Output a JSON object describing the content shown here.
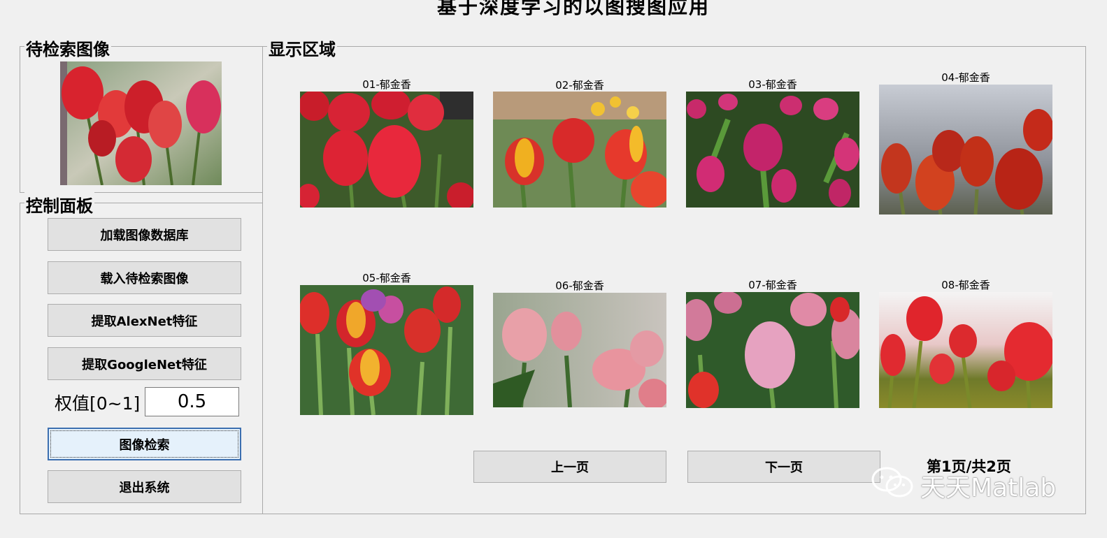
{
  "window": {
    "title": "基于深度学习的以图搜图应用"
  },
  "query_panel": {
    "title": "待检索图像"
  },
  "control_panel": {
    "title": "控制面板",
    "buttons": {
      "load_db": "加载图像数据库",
      "load_query": "载入待检索图像",
      "alexnet": "提取AlexNet特征",
      "googlenet": "提取GoogleNet特征",
      "search": "图像检索",
      "exit": "退出系统"
    },
    "weight": {
      "label": "权值[0~1]",
      "value": "0.5"
    }
  },
  "display_panel": {
    "title": "显示区域",
    "results": [
      {
        "caption": "01-郁金香"
      },
      {
        "caption": "02-郁金香"
      },
      {
        "caption": "03-郁金香"
      },
      {
        "caption": "04-郁金香"
      },
      {
        "caption": "05-郁金香"
      },
      {
        "caption": "06-郁金香"
      },
      {
        "caption": "07-郁金香"
      },
      {
        "caption": "08-郁金香"
      }
    ],
    "prev_label": "上一页",
    "next_label": "下一页",
    "page_info": "第1页/共2页"
  },
  "watermark": {
    "text": "天天Matlab",
    "icon": "wechat-icon"
  },
  "colors": {
    "background": "#f0f0f0",
    "button": "#e1e1e1",
    "active_button": "#e5f1fb",
    "tulip_red": "#d9202c",
    "tulip_pink": "#e0568f"
  }
}
